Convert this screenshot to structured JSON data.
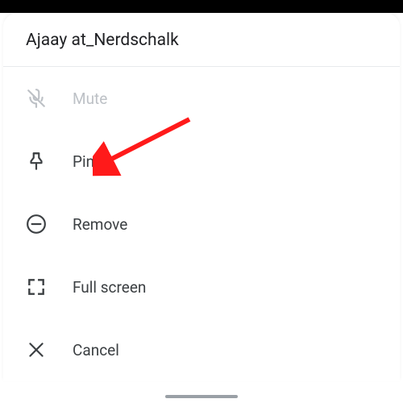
{
  "header": {
    "title": "Ajaay at_Nerdschalk"
  },
  "menu": {
    "mute": {
      "label": "Mute",
      "enabled": false
    },
    "pin": {
      "label": "Pin",
      "enabled": true
    },
    "remove": {
      "label": "Remove",
      "enabled": true
    },
    "fullscreen": {
      "label": "Full screen",
      "enabled": true
    },
    "cancel": {
      "label": "Cancel",
      "enabled": true
    }
  },
  "annotation": {
    "arrow_target": "pin"
  }
}
